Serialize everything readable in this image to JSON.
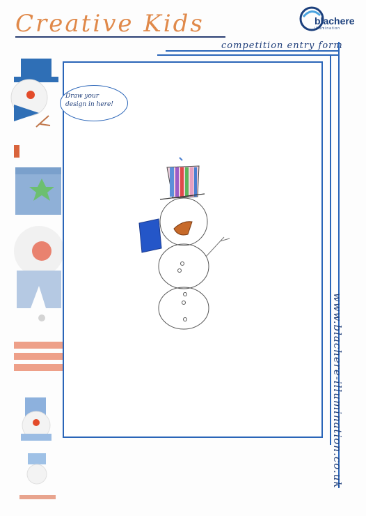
{
  "header": {
    "title": "Creative Kids",
    "subtitle": "competition entry form",
    "logo_name": "blachere",
    "logo_sub": "illumination"
  },
  "bubble": {
    "line1": "Draw your",
    "line2": "design in here!"
  },
  "footer": {
    "url": "www.blachere-illumination.co.uk"
  },
  "colors": {
    "title": "#e0894a",
    "accent": "#2a65b8",
    "navy": "#1f3e7a"
  }
}
